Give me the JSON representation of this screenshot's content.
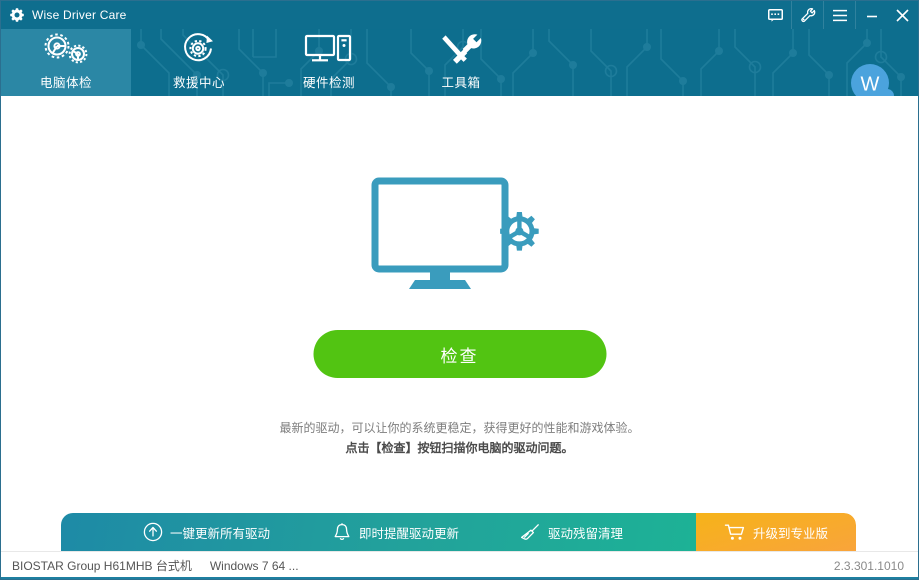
{
  "window": {
    "title": "Wise Driver Care",
    "app_icon": "gear-icon",
    "controls": [
      {
        "name": "feedback-button",
        "icon": "message-bubble-icon"
      },
      {
        "name": "settings-button",
        "icon": "wrench-icon"
      },
      {
        "name": "menu-button",
        "icon": "hamburger-menu-icon"
      },
      {
        "name": "minimize-button",
        "icon": "minimize-icon"
      },
      {
        "name": "close-button",
        "icon": "close-icon"
      }
    ]
  },
  "nav": {
    "tabs": [
      {
        "label": "电脑体检",
        "icon": "two-gears-icon",
        "active": true
      },
      {
        "label": "救援中心",
        "icon": "gear-restore-icon",
        "active": false
      },
      {
        "label": "硬件检测",
        "icon": "monitor-tower-icon",
        "active": false
      },
      {
        "label": "工具箱",
        "icon": "wrench-screwdriver-icon",
        "active": false
      }
    ],
    "avatar": {
      "letter": "W",
      "name": "user-avatar"
    }
  },
  "main": {
    "hero_icon": "monitor-gear-icon",
    "scan_button_label": "检查",
    "description_line1": "最新的驱动，可以让你的系统更稳定，获得更好的性能和游戏体验。",
    "description_line2": "点击【检查】按钮扫描你电脑的驱动问题。"
  },
  "action_bar": {
    "items": [
      {
        "label": "一键更新所有驱动",
        "icon": "up-arrow-circle-icon"
      },
      {
        "label": "即时提醒驱动更新",
        "icon": "bell-icon"
      },
      {
        "label": "驱动残留清理",
        "icon": "broom-icon"
      }
    ],
    "upgrade": {
      "label": "升级到专业版",
      "icon": "shopping-cart-icon"
    }
  },
  "status_bar": {
    "machine": "BIOSTAR Group H61MHB 台式机",
    "os": "Windows 7 64 ...",
    "version": "2.3.301.1010"
  },
  "colors": {
    "titlebar": "#0e6e8e",
    "header": "#0d6e8e",
    "active_tab": "#2b87a5",
    "scan_button": "#52c412",
    "hero_icon": "#3a9cbd",
    "action_bar_start": "#1e8aa6",
    "action_bar_end": "#1db296",
    "upgrade": "#f6b319"
  }
}
